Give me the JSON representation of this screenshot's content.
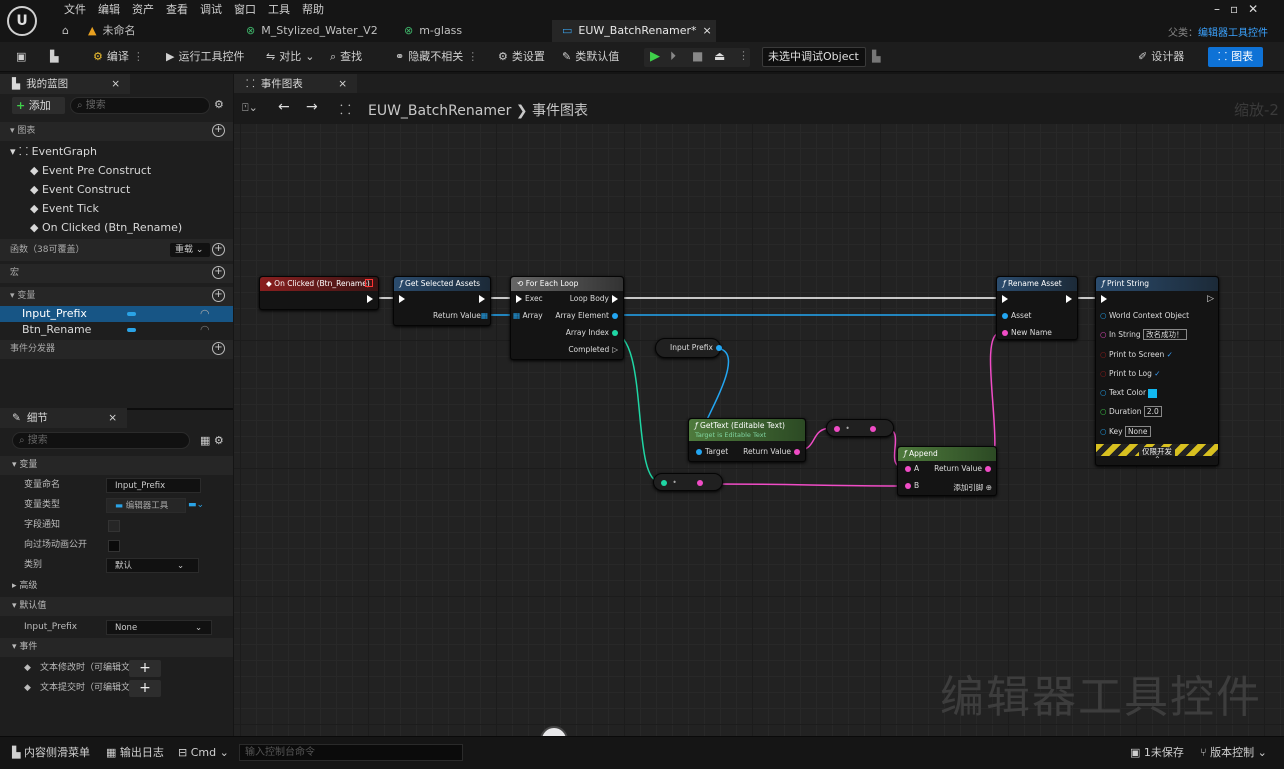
{
  "menu": [
    "文件",
    "编辑",
    "资产",
    "查看",
    "调试",
    "窗口",
    "工具",
    "帮助"
  ],
  "tabs": {
    "home": "⌂",
    "unnamed": "未命名",
    "water": "M_Stylized_Water_V2",
    "glass": "m-glass",
    "active": "EUW_BatchRenamer*",
    "close": "×",
    "parent_label": "父类：",
    "parent_value": "编辑器工具控件"
  },
  "toolbar": {
    "compile": "编译",
    "run": "运行工具控件",
    "diff": "对比",
    "find": "查找",
    "hide": "隐藏不相关",
    "class_settings": "类设置",
    "class_defaults": "类默认值",
    "debug_object": "未选中调试Object",
    "designer": "设计器",
    "graph": "图表"
  },
  "mybp": {
    "tab": "我的蓝图",
    "add": "添加",
    "search_placeholder": "搜索",
    "graphs": "图表",
    "event_graph": "EventGraph",
    "events": [
      "Event Pre Construct",
      "Event Construct",
      "Event Tick",
      "On Clicked (Btn_Rename)"
    ],
    "functions": "函数（38可覆盖）",
    "override": "重载",
    "macros": "宏",
    "variables": "变量",
    "vars": [
      "Input_Prefix",
      "Btn_Rename"
    ],
    "dispatchers": "事件分发器"
  },
  "details": {
    "tab": "细节",
    "search_placeholder": "搜索",
    "var_section": "变量",
    "rows": [
      {
        "label": "变量命名",
        "value": "Input_Prefix"
      },
      {
        "label": "变量类型",
        "value": "编辑器工具"
      },
      {
        "label": "字段通知",
        "value": ""
      },
      {
        "label": "向过场动画公开",
        "value": ""
      },
      {
        "label": "类别",
        "value": "默认"
      }
    ],
    "advanced": "高级",
    "default_section": "默认值",
    "default_label": "Input_Prefix",
    "default_value": "None",
    "event_section": "事件",
    "event_rows": [
      "文本修改时（可编辑文本",
      "文本提交时（可编辑文本"
    ]
  },
  "graph": {
    "tab": "事件图表",
    "crumb_root": "EUW_BatchRenamer",
    "crumb_sep": "❯",
    "crumb_leaf": "事件图表",
    "zoom": "缩放-2",
    "watermark": "编辑器工具控件"
  },
  "nodes": {
    "on_clicked": "On Clicked (Btn_Rename)",
    "get_selected": "Get Selected Assets",
    "return_value": "Return Value",
    "foreach": "For Each Loop",
    "exec": "Exec",
    "array": "Array",
    "loop_body": "Loop Body",
    "array_element": "Array Element",
    "array_index": "Array Index",
    "completed": "Completed",
    "input_prefix": "Input Prefix",
    "gettext": "GetText (Editable Text)",
    "gettext_sub": "Target is Editable Text",
    "target": "Target",
    "append": "Append",
    "a": "A",
    "b": "B",
    "add_pin": "添加引脚",
    "rename": "Rename Asset",
    "asset": "Asset",
    "new_name": "New Name",
    "print": "Print String",
    "world_ctx": "World Context Object",
    "in_string": "In String",
    "in_string_val": "改名成功！",
    "print_screen": "Print to Screen",
    "print_log": "Print to Log",
    "text_color": "Text Color",
    "duration": "Duration",
    "duration_val": "2.0",
    "key": "Key",
    "key_val": "None",
    "dev_only": "仅限开发"
  },
  "status": {
    "content_drawer": "内容侧滑菜单",
    "output_log": "输出日志",
    "cmd": "Cmd",
    "console_placeholder": "输入控制台命令",
    "unsaved": "1未保存",
    "source_control": "版本控制"
  },
  "colors": {
    "accent": "#0e72d6",
    "exec_header": "#7b1f1f",
    "func_header": "#2b4c6e",
    "pure_header": "#4e7a3c",
    "pin_string": "#f04cc6",
    "pin_object": "#22a6f2",
    "pin_int": "#1fd6a4"
  }
}
